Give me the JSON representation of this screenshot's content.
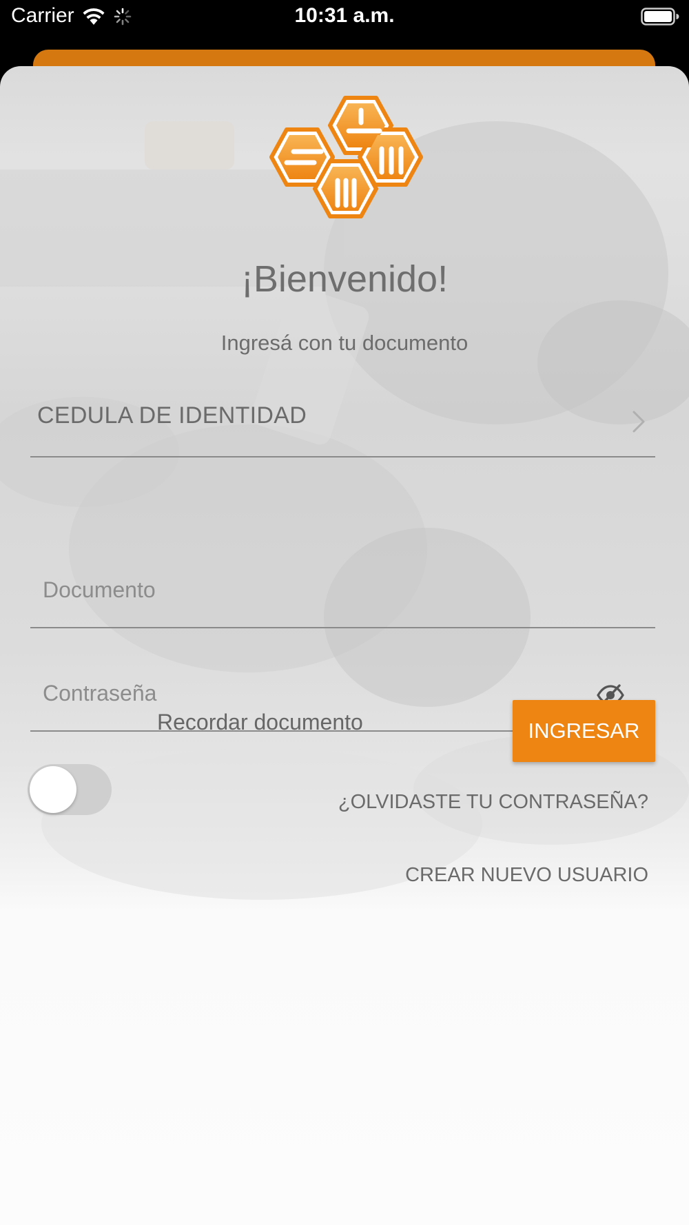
{
  "status_bar": {
    "carrier": "Carrier",
    "time": "10:31 a.m."
  },
  "login": {
    "welcome_title": "¡Bienvenido!",
    "subtitle": "Ingresá con tu documento",
    "document_type": "CEDULA DE IDENTIDAD",
    "document_placeholder": "Documento",
    "password_placeholder": "Contraseña",
    "remember_label": "Recordar documento",
    "remember_enabled": false,
    "login_button": "INGRESAR",
    "forgot_password": "¿OLVIDASTE TU CONTRASEÑA?",
    "create_user": "CREAR NUEVO USUARIO"
  },
  "icons": {
    "status": [
      "wifi-icon",
      "activity-icon",
      "battery-icon"
    ],
    "document_type_chevron": "chevron-right-icon",
    "password_visibility": "eye-off-icon"
  },
  "colors": {
    "accent": "#ee8513",
    "accent_dark": "#d4780f",
    "text": "#6a6a6a",
    "status_bar_bg": "#000000"
  }
}
